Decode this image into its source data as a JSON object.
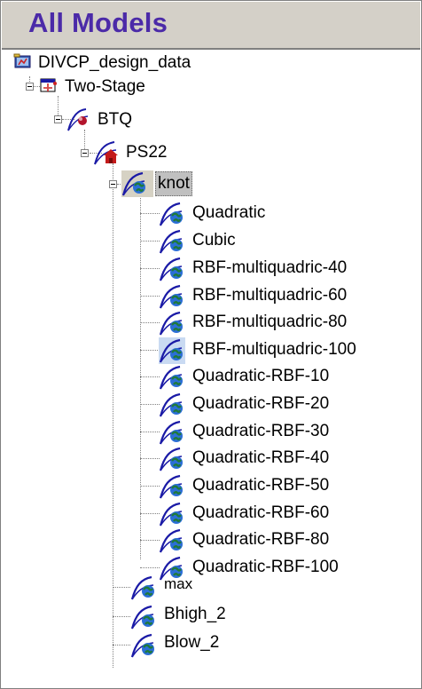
{
  "panel": {
    "title": "All Models"
  },
  "tree": {
    "root": {
      "label": "DIVCP_design_data",
      "icon": "data-folder-icon"
    },
    "two_stage": {
      "label": "Two-Stage",
      "icon": "two-stage-model-icon"
    },
    "btq": {
      "label": "BTQ",
      "icon": "local-model-icon"
    },
    "ps22": {
      "label": "PS22",
      "icon": "house-model-icon"
    },
    "knot": {
      "label": "knot",
      "icon": "response-model-icon",
      "selected": true
    },
    "knot_children": [
      {
        "label": "Quadratic"
      },
      {
        "label": "Cubic"
      },
      {
        "label": "RBF-multiquadric-40"
      },
      {
        "label": "RBF-multiquadric-60"
      },
      {
        "label": "RBF-multiquadric-80"
      },
      {
        "label": "RBF-multiquadric-100",
        "highlighted": true
      },
      {
        "label": "Quadratic-RBF-10"
      },
      {
        "label": "Quadratic-RBF-20"
      },
      {
        "label": "Quadratic-RBF-30"
      },
      {
        "label": "Quadratic-RBF-40"
      },
      {
        "label": "Quadratic-RBF-50"
      },
      {
        "label": "Quadratic-RBF-60"
      },
      {
        "label": "Quadratic-RBF-80"
      },
      {
        "label": "Quadratic-RBF-100"
      }
    ],
    "ps22_siblings": [
      {
        "label": "max"
      },
      {
        "label": "Bhigh_2"
      },
      {
        "label": "Blow_2"
      }
    ]
  },
  "colors": {
    "title": "#4b2aa8",
    "curve": "#1a1aa6",
    "globe": "#1f7a3a",
    "globe_water": "#2b6fd6",
    "highlight": "#c9daf2"
  }
}
